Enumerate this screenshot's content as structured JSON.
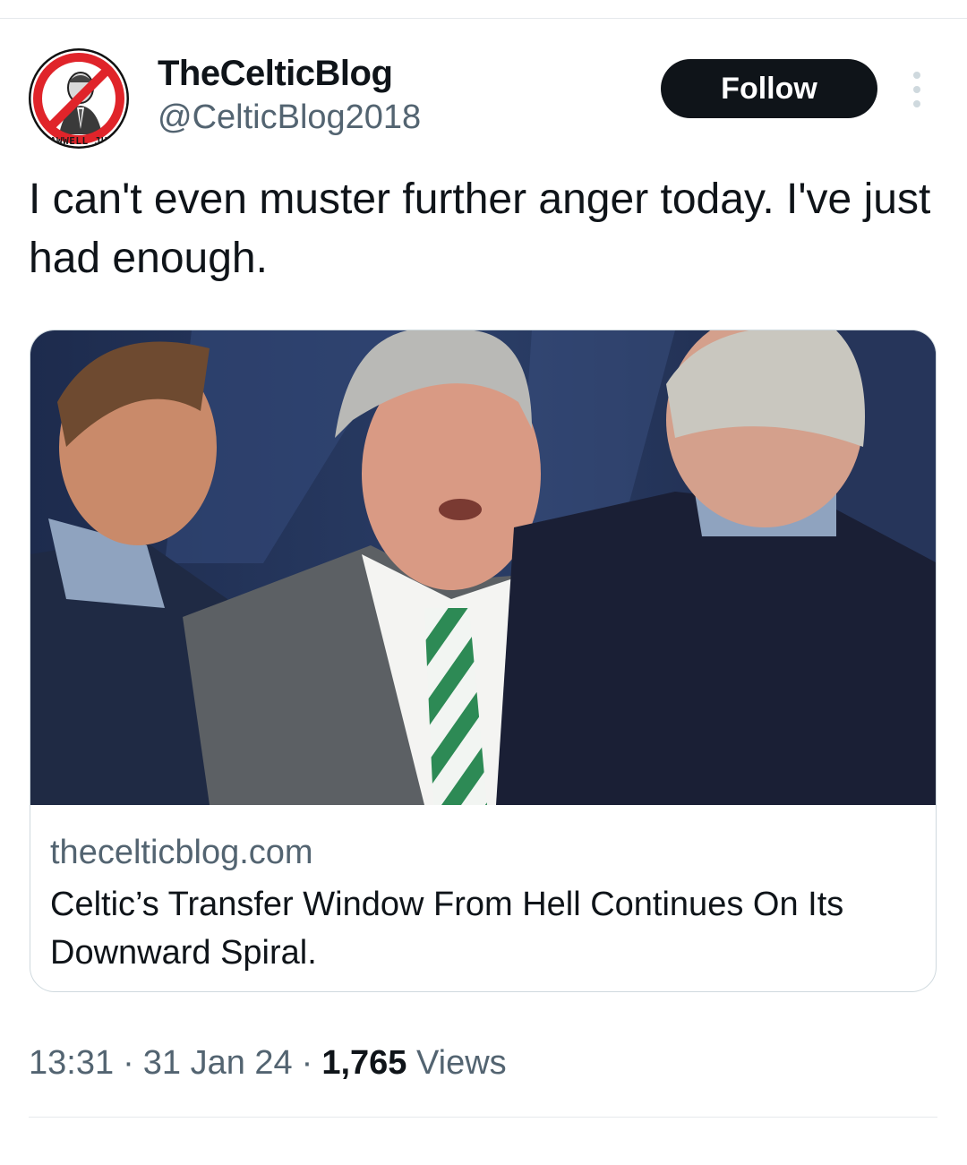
{
  "author": {
    "display_name": "TheCelticBlog",
    "handle": "@CelticBlog2018",
    "avatar_caption": "LAWWELL JUN"
  },
  "header": {
    "follow_label": "Follow",
    "more_icon": "more-vertical-icon"
  },
  "tweet": {
    "text": "I can't even muster further anger today. I've just had enough."
  },
  "link_card": {
    "domain": "thecelticblog.com",
    "title": "Celtic’s Transfer Window From Hell Continues On Its Downward Spiral."
  },
  "meta": {
    "time": "13:31",
    "date": "31 Jan 24",
    "views_count": "1,765",
    "views_label": "Views",
    "separator": "·"
  },
  "colors": {
    "text": "#0f1419",
    "secondary": "#536471",
    "divider": "#e6e9ec",
    "follow_bg": "#0f1419",
    "avatar_ring": "#e0242a"
  }
}
